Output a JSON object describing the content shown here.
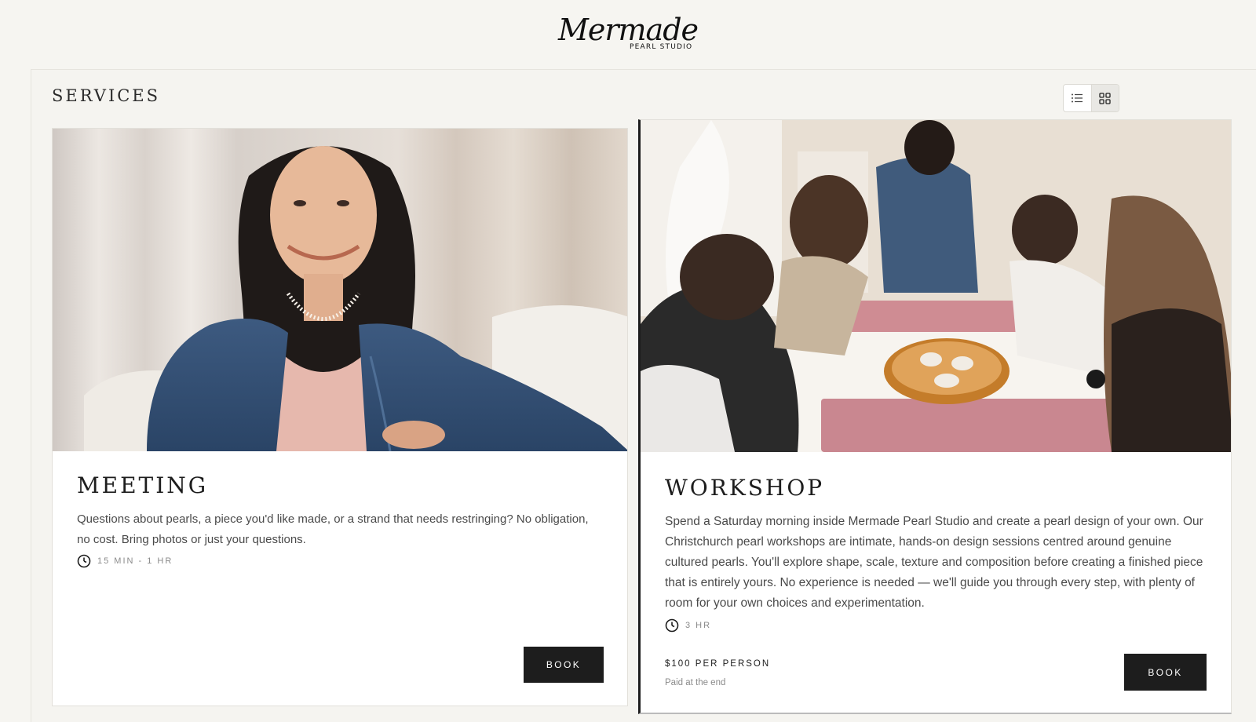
{
  "brand": {
    "logo_main": "Mermade",
    "logo_sub": "PEARL STUDIO"
  },
  "section": {
    "title": "SERVICES"
  },
  "view_toggle": {
    "options": [
      "list-icon",
      "grid-icon"
    ],
    "selected": "grid"
  },
  "services": [
    {
      "title": "MEETING",
      "description": "Questions about pearls, a piece you'd like made, or a strand that needs restringing? No obligation, no cost. Bring photos or just your questions.",
      "duration": "15 MIN - 1 HR",
      "button_label": "BOOK",
      "image_alt": "Smiling woman in denim jacket wearing a pearl necklace"
    },
    {
      "title": "WORKSHOP",
      "description": "Spend a Saturday morning inside Mermade Pearl Studio and create a pearl design of your own. Our Christchurch pearl workshops are intimate, hands-on design sessions centred around genuine cultured pearls. You'll explore shape, scale, texture and composition before creating a finished piece that is entirely yours. No experience is needed — we'll guide you through every step, with plenty of room for your own choices and experimentation.",
      "duration": "3 HR",
      "price": "$100 PER PERSON",
      "price_note": "Paid at the end",
      "button_label": "BOOK",
      "image_alt": "Group of women working at a table with pearls and beading trays"
    }
  ],
  "colors": {
    "background": "#f6f5f1",
    "button": "#1d1d1d",
    "text": "#1d1d1d",
    "muted": "#8a8a8a"
  }
}
